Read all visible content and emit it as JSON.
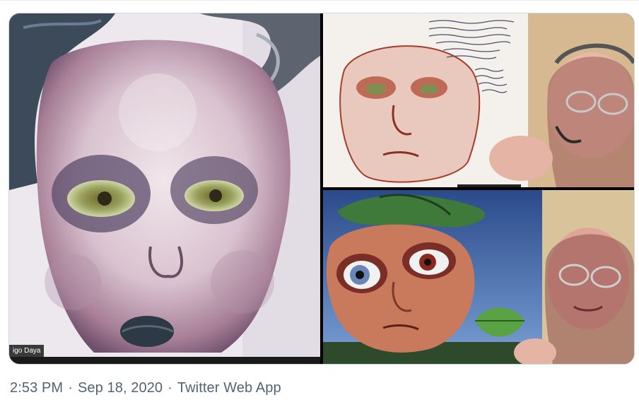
{
  "tweet": {
    "media": {
      "left_tile": {
        "name_tag": "igo Daya"
      }
    },
    "meta": {
      "time": "2:53 PM",
      "date": "Sep 18, 2020",
      "source": "Twitter Web App",
      "separator": "·"
    }
  },
  "colors": {
    "meta_text": "#536471",
    "border": "#cfd9de"
  },
  "icons": []
}
